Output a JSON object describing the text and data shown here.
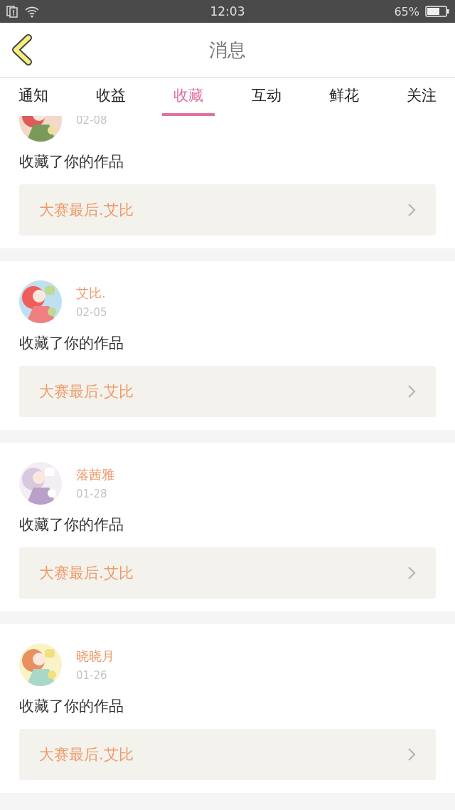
{
  "status_bar": {
    "time": "12:03",
    "battery": "65%"
  },
  "header": {
    "title": "消息"
  },
  "tabs": [
    {
      "label": "通知",
      "selected": false
    },
    {
      "label": "收益",
      "selected": false
    },
    {
      "label": "收藏",
      "selected": true
    },
    {
      "label": "互动",
      "selected": false
    },
    {
      "label": "鲜花",
      "selected": false
    },
    {
      "label": "关注",
      "selected": false
    }
  ],
  "messages": [
    {
      "date": "02-08",
      "text": "收藏了你的作品",
      "work": "大赛最后.艾比"
    },
    {
      "name": "艾比.",
      "date": "02-05",
      "text": "收藏了你的作品",
      "work": "大赛最后.艾比"
    },
    {
      "name": "落茜雅",
      "date": "01-28",
      "text": "收藏了你的作品",
      "work": "大赛最后.艾比"
    },
    {
      "name": "晓晓月",
      "date": "01-26",
      "text": "收藏了你的作品",
      "work": "大赛最后.艾比"
    }
  ]
}
